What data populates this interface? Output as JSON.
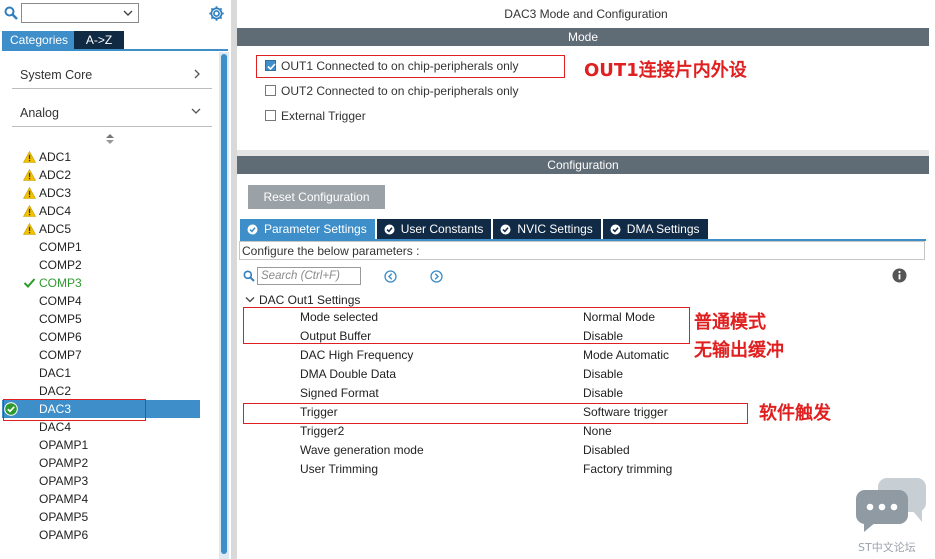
{
  "left_panel": {
    "category_tabs": {
      "categories": "Categories",
      "az": "A->Z"
    },
    "groups": [
      {
        "label": "System Core",
        "expanded": false
      },
      {
        "label": "Analog",
        "expanded": true
      }
    ],
    "peripherals": [
      {
        "name": "ADC1",
        "status": "warning"
      },
      {
        "name": "ADC2",
        "status": "warning"
      },
      {
        "name": "ADC3",
        "status": "warning"
      },
      {
        "name": "ADC4",
        "status": "warning"
      },
      {
        "name": "ADC5",
        "status": "warning"
      },
      {
        "name": "COMP1",
        "status": "none"
      },
      {
        "name": "COMP2",
        "status": "none"
      },
      {
        "name": "COMP3",
        "status": "ok"
      },
      {
        "name": "COMP4",
        "status": "none"
      },
      {
        "name": "COMP5",
        "status": "none"
      },
      {
        "name": "COMP6",
        "status": "none"
      },
      {
        "name": "COMP7",
        "status": "none"
      },
      {
        "name": "DAC1",
        "status": "none"
      },
      {
        "name": "DAC2",
        "status": "none"
      },
      {
        "name": "DAC3",
        "status": "selected"
      },
      {
        "name": "DAC4",
        "status": "none"
      },
      {
        "name": "OPAMP1",
        "status": "none"
      },
      {
        "name": "OPAMP2",
        "status": "none"
      },
      {
        "name": "OPAMP3",
        "status": "none"
      },
      {
        "name": "OPAMP4",
        "status": "none"
      },
      {
        "name": "OPAMP5",
        "status": "none"
      },
      {
        "name": "OPAMP6",
        "status": "none"
      }
    ]
  },
  "main": {
    "title": "DAC3 Mode and Configuration",
    "mode_section": {
      "header": "Mode",
      "checkboxes": [
        {
          "label": "OUT1 Connected to on chip-peripherals only",
          "checked": true
        },
        {
          "label": "OUT2 Connected to on chip-peripherals only",
          "checked": false
        },
        {
          "label": "External Trigger",
          "checked": false
        }
      ]
    },
    "config_section": {
      "header": "Configuration",
      "reset_button": "Reset Configuration",
      "tabs": [
        {
          "label": "Parameter Settings",
          "active": true
        },
        {
          "label": "User Constants",
          "active": false
        },
        {
          "label": "NVIC Settings",
          "active": false
        },
        {
          "label": "DMA Settings",
          "active": false
        }
      ],
      "configure_text": "Configure the below parameters :",
      "search_placeholder": "Search (Ctrl+F)",
      "group_label": "DAC Out1 Settings",
      "parameters": [
        {
          "name": "Mode selected",
          "value": "Normal Mode"
        },
        {
          "name": "Output Buffer",
          "value": "Disable"
        },
        {
          "name": "DAC High Frequency",
          "value": "Mode Automatic"
        },
        {
          "name": "DMA Double Data",
          "value": "Disable"
        },
        {
          "name": "Signed Format",
          "value": "Disable"
        },
        {
          "name": "Trigger",
          "value": "Software trigger"
        },
        {
          "name": "Trigger2",
          "value": "None"
        },
        {
          "name": "Wave generation mode",
          "value": "Disabled"
        },
        {
          "name": "User Trimming",
          "value": "Factory trimming"
        }
      ]
    }
  },
  "annotations": {
    "out1": "OUT1连接片内外设",
    "mode_line1": "普通模式",
    "mode_line2": "无输出缓冲",
    "trigger": "软件触发"
  },
  "watermark": "ST中文论坛",
  "colors": {
    "accent_blue": "#3d8ec9",
    "dark_navy": "#112a45",
    "section_gray": "#5f6b75",
    "annotation_red": "#e02020",
    "warning_yellow": "#f2c200",
    "ok_green": "#2e9a2e"
  }
}
